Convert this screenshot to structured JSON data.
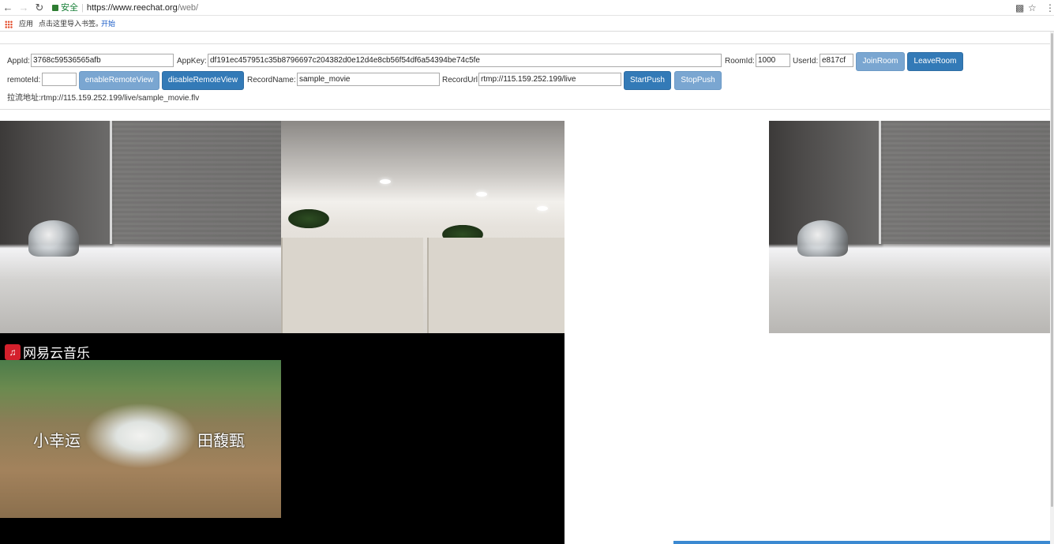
{
  "browser": {
    "secure_label": "安全",
    "url_host": "https://www.reechat.org",
    "url_path": "/web/",
    "bookmarks": {
      "apps_label": "应用",
      "import_text": "点击这里导入书签。",
      "start_link": "开始"
    }
  },
  "form": {
    "appid_label": "AppId:",
    "appid_value": "3768c59536565afb",
    "appkey_label": "AppKey:",
    "appkey_value": "df191ec457951c35b8796697c204382d0e12d4e8cb56f54df6a54394be74c5fe",
    "roomid_label": "RoomId:",
    "roomid_value": "1000",
    "userid_label": "UserId:",
    "userid_value": "e817cf",
    "join_room": "JoinRoom",
    "leave_room": "LeaveRoom",
    "remoteid_label": "remoteId:",
    "remoteid_value": "",
    "enable_remote_view": "enableRemoteView",
    "disable_remote_view": "disableRemoteView",
    "record_name_label": "RecordName:",
    "record_name_value": "sample_movie",
    "record_url_label": "RecordUrl",
    "record_url_value": "rtmp://115.159.252.199/live",
    "start_push": "StartPush",
    "stop_push": "StopPush",
    "pull_url_label": "拉流地址:",
    "pull_url_value": "rtmp://115.159.252.199/live/sample_movie.flv"
  },
  "video": {
    "logo_text": "网易云音乐",
    "subtitle_left": "小幸运",
    "subtitle_right": "田馥甄"
  },
  "colors": {
    "primary_button": "#337ab7",
    "disabled_button": "#7aa6d1"
  }
}
